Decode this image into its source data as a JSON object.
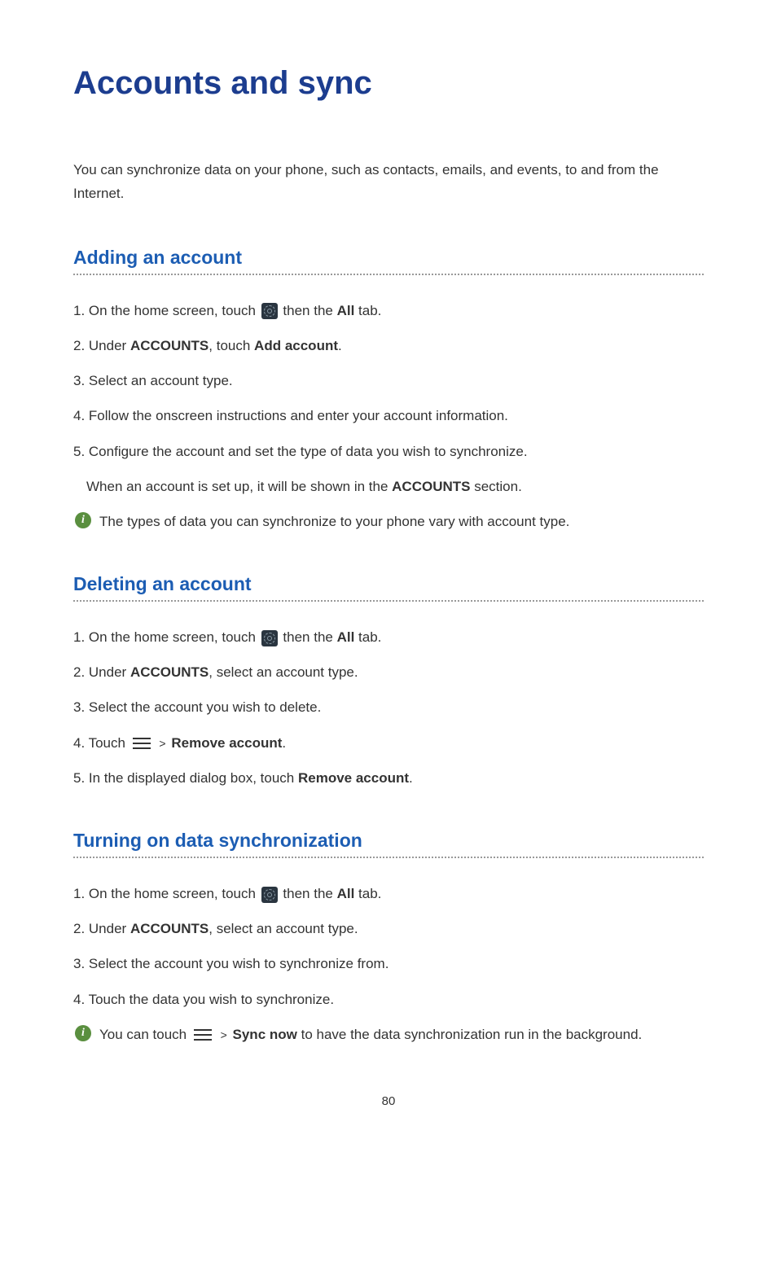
{
  "title": "Accounts and sync",
  "intro": "You can synchronize data on your phone, such as contacts, emails, and events, to and from the Internet.",
  "sections": {
    "adding": {
      "heading": "Adding an account",
      "steps": {
        "s1_pre": "On the home screen, touch ",
        "s1_mid": " then the ",
        "s1_bold": "All",
        "s1_post": " tab.",
        "s2_pre": "Under ",
        "s2_b1": "ACCOUNTS",
        "s2_mid": ", touch ",
        "s2_b2": "Add account",
        "s2_post": ".",
        "s3": "Select an account type.",
        "s4": "Follow the onscreen instructions and enter your account information.",
        "s5": "Configure the account and set the type of data you wish to synchronize.",
        "s5_note_pre": "When an account is set up, it will be shown in the ",
        "s5_note_bold": "ACCOUNTS",
        "s5_note_post": " section."
      },
      "info": "The types of data you can synchronize to your phone vary with account type."
    },
    "deleting": {
      "heading": "Deleting an account",
      "steps": {
        "s1_pre": "On the home screen, touch ",
        "s1_mid": " then the ",
        "s1_bold": "All",
        "s1_post": " tab.",
        "s2_pre": "Under ",
        "s2_b1": "ACCOUNTS",
        "s2_post": ", select an account type.",
        "s3": "Select the account you wish to delete.",
        "s4_pre": "Touch ",
        "s4_bold": "Remove account",
        "s4_post": ".",
        "s5_pre": "In the displayed dialog box, touch ",
        "s5_bold": "Remove account",
        "s5_post": "."
      }
    },
    "sync": {
      "heading": "Turning on data synchronization",
      "steps": {
        "s1_pre": "On the home screen, touch ",
        "s1_mid": " then the ",
        "s1_bold": "All",
        "s1_post": " tab.",
        "s2_pre": "Under ",
        "s2_b1": "ACCOUNTS",
        "s2_post": ", select an account type.",
        "s3": "Select the account you wish to synchronize from.",
        "s4": "Touch the data you wish to synchronize."
      },
      "info_pre": "You can touch ",
      "info_bold": "Sync now",
      "info_post": " to have the data synchronization run in the background."
    }
  },
  "numbers": {
    "n1": "1. ",
    "n2": "2. ",
    "n3": "3. ",
    "n4": "4. ",
    "n5": "5. "
  },
  "gt": ">",
  "info_glyph": "i",
  "page_number": "80"
}
